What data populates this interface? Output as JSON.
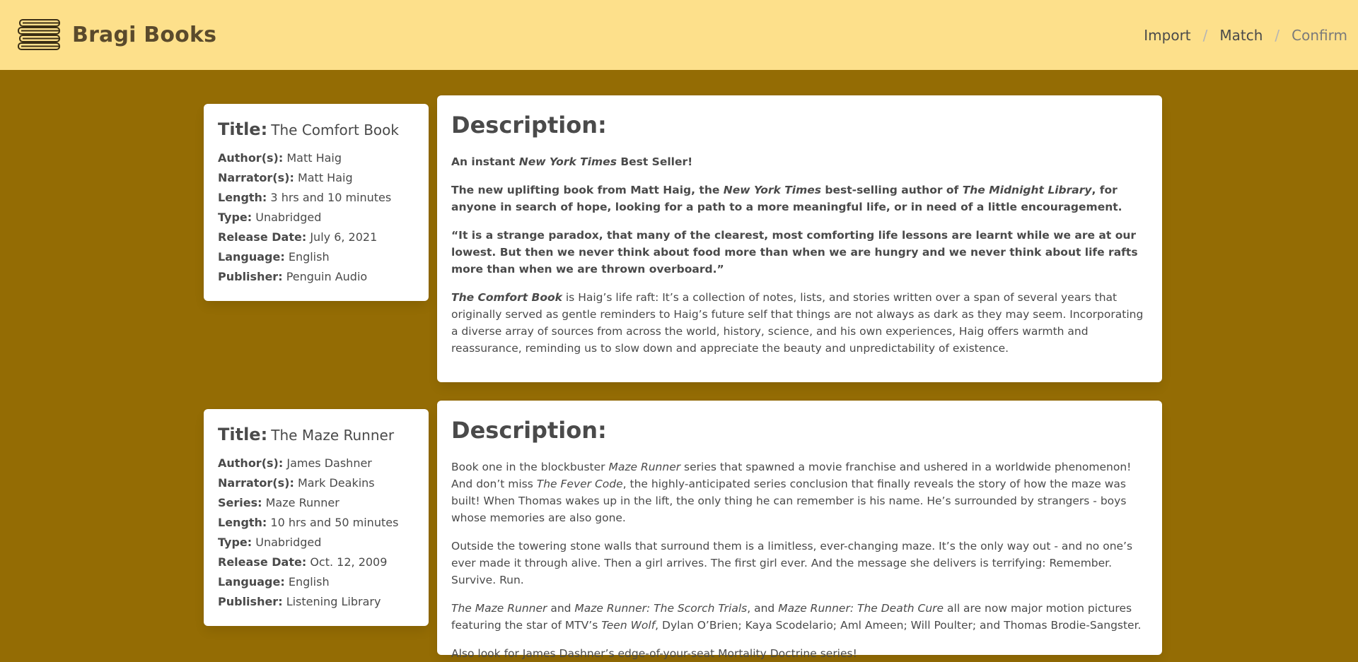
{
  "app": {
    "name": "Bragi Books",
    "logo_icon": "books-stack-icon",
    "colors": {
      "navbar": "#fde08b",
      "background": "#946c04",
      "card": "#ffffff"
    }
  },
  "breadcrumb": {
    "items": [
      "Import",
      "Match",
      "Confirm"
    ],
    "separator": "/"
  },
  "books": [
    {
      "title_label": "Title:",
      "title": "The Comfort Book",
      "fields": [
        {
          "label": "Author(s):",
          "value": "Matt Haig"
        },
        {
          "label": "Narrator(s):",
          "value": "Matt Haig"
        },
        {
          "label": "Length:",
          "value": "3 hrs and 10 minutes"
        },
        {
          "label": "Type:",
          "value": "Unabridged"
        },
        {
          "label": "Release Date:",
          "value": "July 6, 2021"
        },
        {
          "label": "Language:",
          "value": "English"
        },
        {
          "label": "Publisher:",
          "value": "Penguin Audio"
        }
      ],
      "description_heading": "Description:",
      "description": [
        {
          "bold": true,
          "segments": [
            {
              "t": "An instant "
            },
            {
              "t": "New York Times",
              "i": true
            },
            {
              "t": " Best Seller!"
            }
          ]
        },
        {
          "bold": true,
          "segments": [
            {
              "t": "The new uplifting book from Matt Haig, the "
            },
            {
              "t": "New York Times",
              "i": true
            },
            {
              "t": " best-selling author of "
            },
            {
              "t": "The Midnight Library",
              "i": true
            },
            {
              "t": ", for anyone in search of hope, looking for a path to a more meaningful life, or in need of a little encouragement."
            }
          ]
        },
        {
          "bold": true,
          "segments": [
            {
              "t": "“It is a strange paradox, that many of the clearest, most comforting life lessons are learnt while we are at our lowest. But then we never think about food more than when we are hungry and we never think about life rafts more than when we are thrown overboard.”"
            }
          ]
        },
        {
          "bold": false,
          "segments": [
            {
              "t": "The Comfort Book",
              "i": true,
              "b": true
            },
            {
              "t": " is Haig’s life raft: It’s a collection of notes, lists, and stories written over a span of several years that originally served as gentle reminders to Haig’s future self that things are not always as dark as they may seem. Incorporating a diverse array of sources from across the world, history, science, and his own experiences, Haig offers warmth and reassurance, reminding us to slow down and appreciate the beauty and unpredictability of existence."
            }
          ]
        }
      ]
    },
    {
      "title_label": "Title:",
      "title": "The Maze Runner",
      "fields": [
        {
          "label": "Author(s):",
          "value": "James Dashner"
        },
        {
          "label": "Narrator(s):",
          "value": "Mark Deakins"
        },
        {
          "label": "Series:",
          "value": "Maze Runner"
        },
        {
          "label": "Length:",
          "value": "10 hrs and 50 minutes"
        },
        {
          "label": "Type:",
          "value": "Unabridged"
        },
        {
          "label": "Release Date:",
          "value": "Oct. 12, 2009"
        },
        {
          "label": "Language:",
          "value": "English"
        },
        {
          "label": "Publisher:",
          "value": "Listening Library"
        }
      ],
      "description_heading": "Description:",
      "description": [
        {
          "bold": false,
          "segments": [
            {
              "t": "Book one in the blockbuster "
            },
            {
              "t": "Maze Runner",
              "i": true
            },
            {
              "t": " series that spawned a movie franchise and ushered in a worldwide phenomenon! And don’t miss "
            },
            {
              "t": "The Fever Code",
              "i": true
            },
            {
              "t": ", the highly-anticipated series conclusion that finally reveals the story of how the maze was built! When Thomas wakes up in the lift, the only thing he can remember is his name. He’s surrounded by strangers - boys whose memories are also gone."
            }
          ]
        },
        {
          "bold": false,
          "segments": [
            {
              "t": "Outside the towering stone walls that surround them is a limitless, ever-changing maze. It’s the only way out - and no one’s ever made it through alive. Then a girl arrives. The first girl ever. And the message she delivers is terrifying: Remember. Survive. Run."
            }
          ]
        },
        {
          "bold": false,
          "segments": [
            {
              "t": "The Maze Runner",
              "i": true
            },
            {
              "t": " and "
            },
            {
              "t": "Maze Runner: The Scorch Trials",
              "i": true
            },
            {
              "t": ", and "
            },
            {
              "t": "Maze Runner: The Death Cure",
              "i": true
            },
            {
              "t": " all are now major motion pictures featuring the star of MTV’s "
            },
            {
              "t": "Teen Wolf",
              "i": true
            },
            {
              "t": ", Dylan O’Brien; Kaya Scodelario; Aml Ameen; Will Poulter; and Thomas Brodie-Sangster."
            }
          ]
        },
        {
          "bold": false,
          "segments": [
            {
              "t": "Also look for James Dashner’s edge-of-your-seat Mortality Doctrine series!"
            }
          ]
        }
      ]
    }
  ]
}
